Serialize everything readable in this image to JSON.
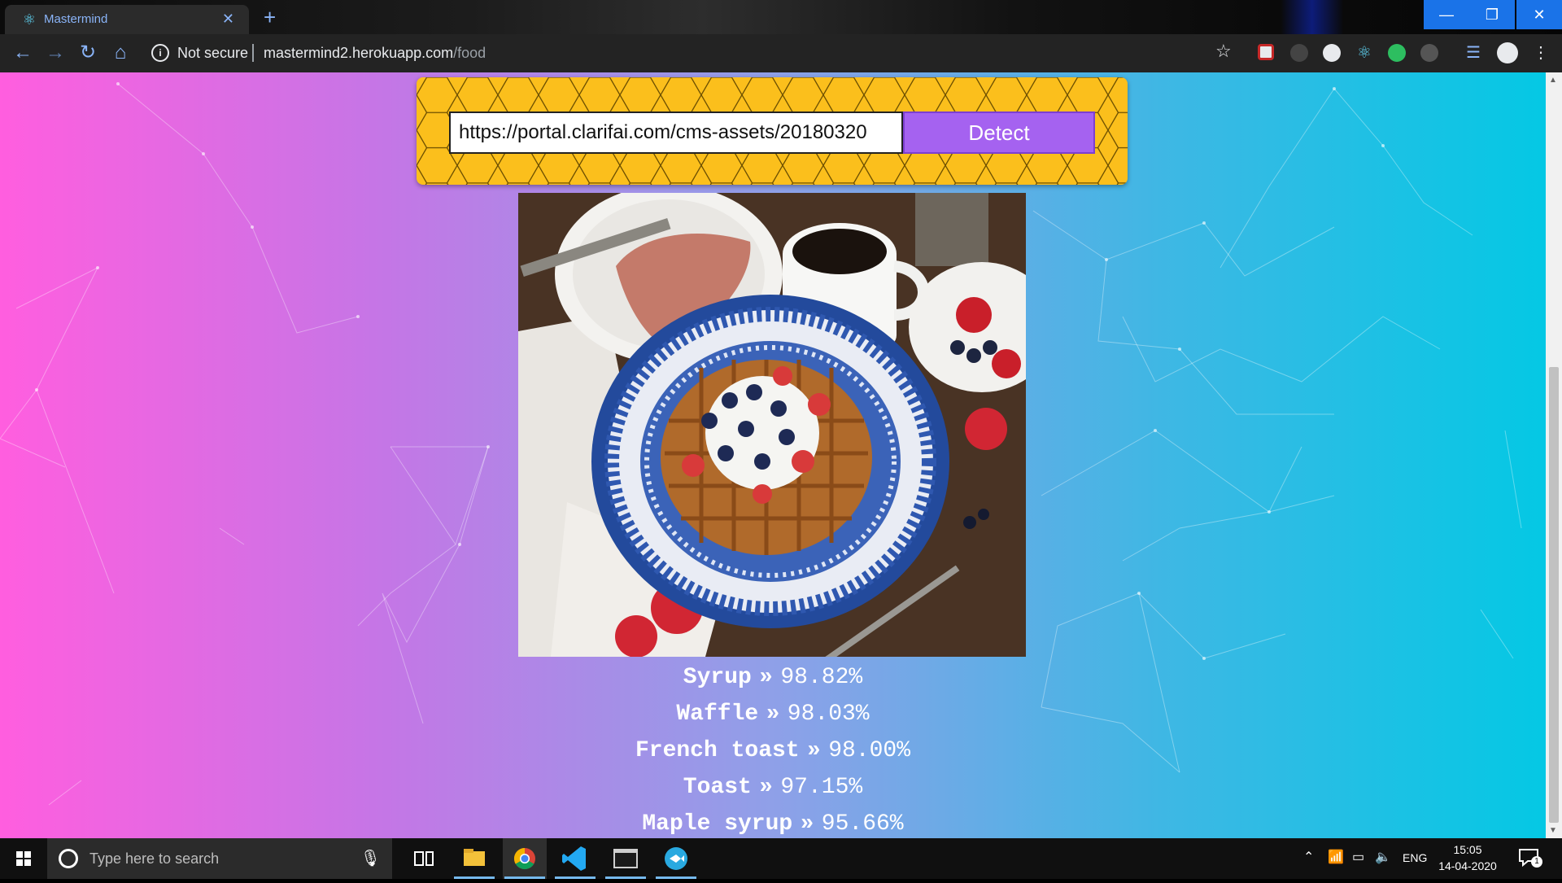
{
  "browser": {
    "tab_title": "Mastermind",
    "address": {
      "security_label": "Not secure",
      "host": "mastermind2.herokuapp.com",
      "path": "/food"
    }
  },
  "form": {
    "url_value": "https://portal.clarifai.com/cms-assets/20180320",
    "detect_label": "Detect"
  },
  "image": {
    "subject": "waffle with yogurt, blueberries and strawberries, coffee, toast"
  },
  "predictions": [
    {
      "name": "Syrup",
      "arrow": "»",
      "score": "98.82%"
    },
    {
      "name": "Waffle",
      "arrow": "»",
      "score": "98.03%"
    },
    {
      "name": "French toast",
      "arrow": "»",
      "score": "98.00%"
    },
    {
      "name": "Toast",
      "arrow": "»",
      "score": "97.15%"
    },
    {
      "name": "Maple syrup",
      "arrow": "»",
      "score": "95.66%"
    }
  ],
  "taskbar": {
    "search_placeholder": "Type here to search",
    "language": "ENG",
    "time": "15:05",
    "date": "14-04-2020",
    "notifications": "1"
  },
  "colors": {
    "form_bg": "#fbbf1c",
    "detect_bg": "#a562f0",
    "gradient_left": "#ff5edf",
    "gradient_right": "#04c8e4"
  }
}
